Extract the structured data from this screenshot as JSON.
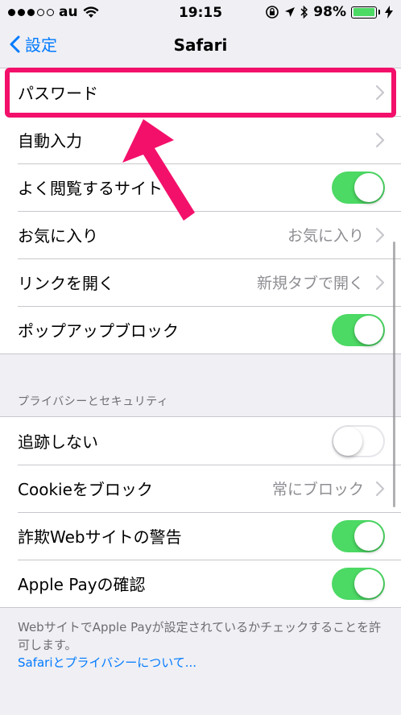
{
  "status_bar": {
    "carrier": "au",
    "time": "19:15",
    "battery_percent": "98%",
    "battery_level": 0.98
  },
  "nav": {
    "back_label": "設定",
    "title": "Safari"
  },
  "group1": {
    "rows": [
      {
        "label": "パスワード",
        "detail": "",
        "type": "chevron"
      },
      {
        "label": "自動入力",
        "detail": "",
        "type": "chevron"
      },
      {
        "label": "よく閲覧するサイト",
        "type": "toggle",
        "on": true
      },
      {
        "label": "お気に入り",
        "detail": "お気に入り",
        "type": "chevron"
      },
      {
        "label": "リンクを開く",
        "detail": "新規タブで開く",
        "type": "chevron"
      },
      {
        "label": "ポップアップブロック",
        "type": "toggle",
        "on": true
      }
    ]
  },
  "privacy": {
    "header": "プライバシーとセキュリティ",
    "rows": [
      {
        "label": "追跡しない",
        "type": "toggle",
        "on": false
      },
      {
        "label": "Cookieをブロック",
        "detail": "常にブロック",
        "type": "chevron"
      },
      {
        "label": "詐欺Webサイトの警告",
        "type": "toggle",
        "on": true
      },
      {
        "label": "Apple Payの確認",
        "type": "toggle",
        "on": true
      }
    ],
    "footer_text": "WebサイトでApple Payが設定されているかチェックすることを許可します。",
    "footer_link": "Safariとプライバシーについて..."
  },
  "colors": {
    "accent": "#007aff",
    "toggle_on": "#4cd964",
    "highlight": "#f3106b"
  }
}
